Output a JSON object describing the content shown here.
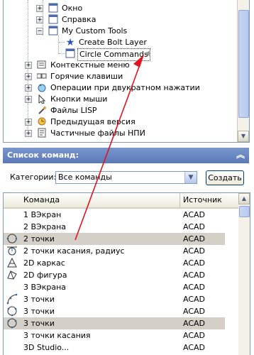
{
  "tree": {
    "items": [
      {
        "label": "Окно",
        "icon": "toolbar-icon",
        "expander": "plus"
      },
      {
        "label": "Справка",
        "icon": "toolbar-icon",
        "expander": "plus"
      },
      {
        "label": "My Custom Tools",
        "icon": "toolbar-icon",
        "expander": "minus"
      },
      {
        "label": "Create Bolt Layer",
        "icon": "star-icon"
      },
      {
        "label": "Circle Commands",
        "icon": "toolbar-icon"
      },
      {
        "label": "Контекстные меню",
        "icon": "context-menu-icon",
        "expander": "plus"
      },
      {
        "label": "Горячие клавиши",
        "icon": "keyboard-icon",
        "expander": "plus"
      },
      {
        "label": "Операции при двукратном нажатии",
        "icon": "double-click-icon",
        "expander": "plus"
      },
      {
        "label": "Кнопки мыши",
        "icon": "mouse-icon",
        "expander": "plus"
      },
      {
        "label": "Файлы LISP",
        "icon": "lisp-icon"
      },
      {
        "label": "Предыдущая версия",
        "icon": "legacy-icon",
        "expander": "plus"
      },
      {
        "label": "Частичные файлы НПИ",
        "icon": "partial-cui-icon",
        "expander": "plus"
      }
    ]
  },
  "command_list": {
    "title": "Список команд:",
    "category_label": "Категории:",
    "category_value": "Все команды",
    "create_button": "Создать",
    "columns": {
      "command": "Команда",
      "source": "Источник"
    },
    "rows": [
      {
        "icon": "",
        "name": "1 ВЭкран",
        "source": "ACAD"
      },
      {
        "icon": "",
        "name": "2 ВЭкрана",
        "source": "ACAD"
      },
      {
        "icon": "circle-2p-icon",
        "name": "2 точки",
        "source": "ACAD",
        "selected": true
      },
      {
        "icon": "circle-ttr-icon",
        "name": "2 точки касания, радиус",
        "source": "ACAD"
      },
      {
        "icon": "wireframe-2d-icon",
        "name": "2D каркас",
        "source": "ACAD"
      },
      {
        "icon": "solid-2d-icon",
        "name": "2D фигура",
        "source": "ACAD"
      },
      {
        "icon": "",
        "name": "3 ВЭкрана",
        "source": "ACAD"
      },
      {
        "icon": "arc-3p-icon",
        "name": "3 точки",
        "source": "ACAD"
      },
      {
        "icon": "circle-3p-icon",
        "name": "3 точки",
        "source": "ACAD"
      },
      {
        "icon": "circle-3p-icon",
        "name": "3 точки",
        "source": "ACAD",
        "selected": true
      },
      {
        "icon": "",
        "name": "3 точки касания",
        "source": "ACAD"
      },
      {
        "icon": "",
        "name": "3D Studio...",
        "source": "ACAD"
      }
    ]
  },
  "colors": {
    "header_bar": "#6585c4",
    "selection": "#d4d0c8",
    "annotation_arrow": "#e0141e"
  }
}
